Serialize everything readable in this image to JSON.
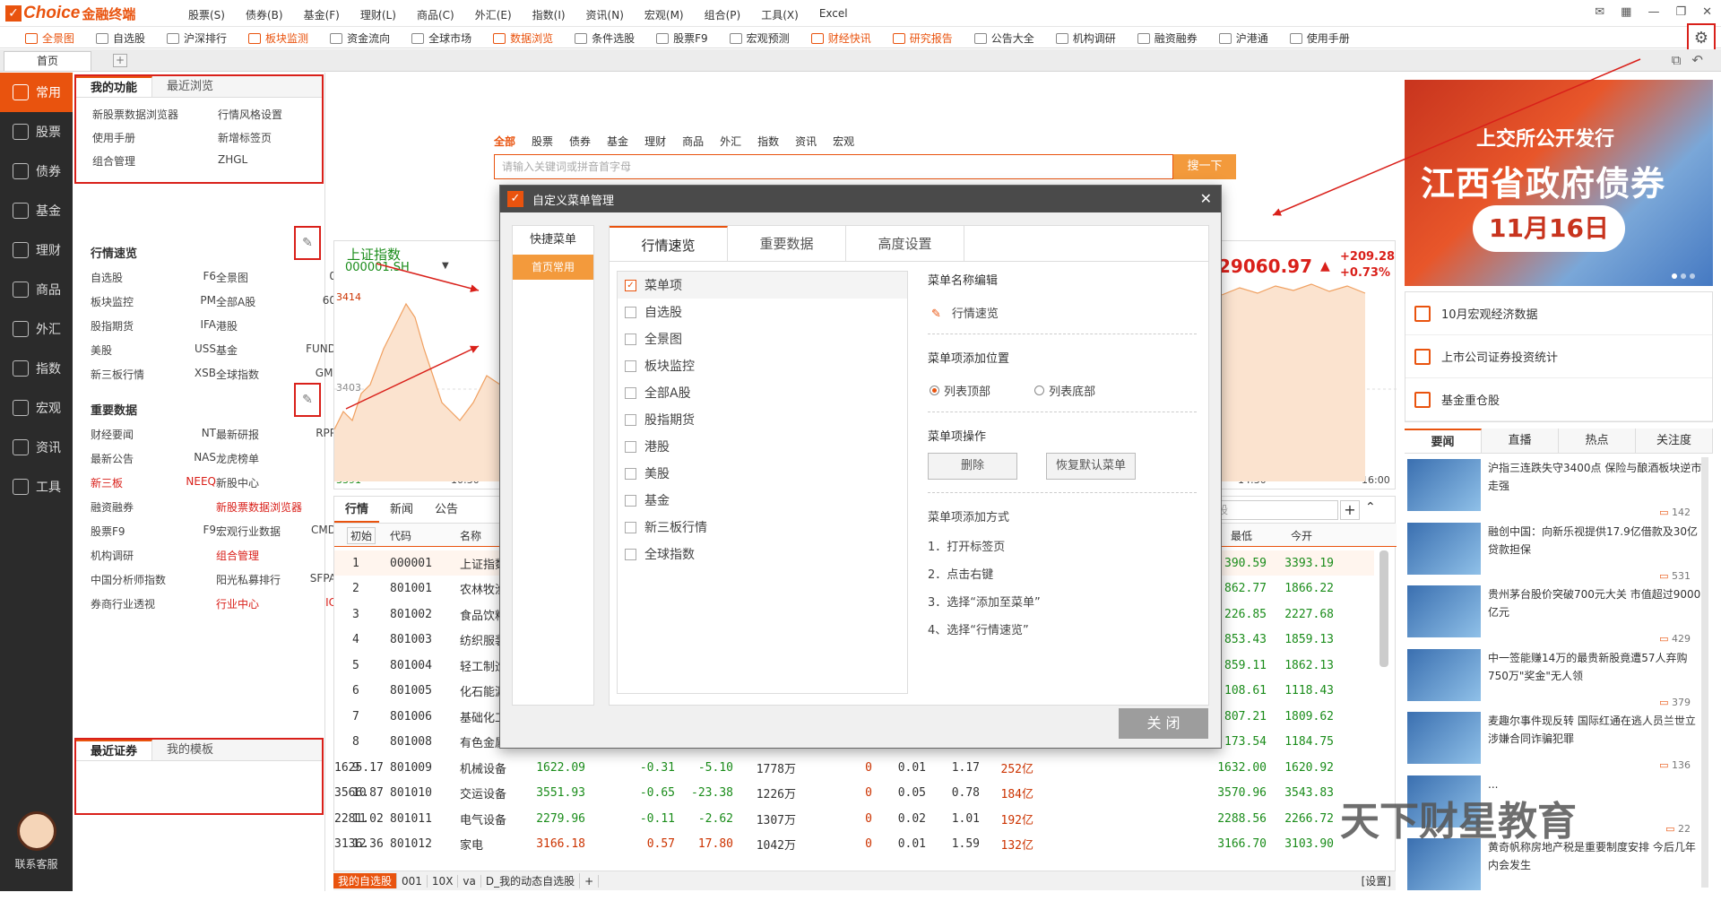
{
  "app": {
    "logo": "Choice",
    "logo_sub": "金融终端"
  },
  "menu": [
    "股票(S)",
    "债券(B)",
    "基金(F)",
    "理财(L)",
    "商品(C)",
    "外汇(E)",
    "指数(I)",
    "资讯(N)",
    "宏观(M)",
    "组合(P)",
    "工具(X)",
    "Excel"
  ],
  "toolbar": [
    {
      "label": "全景图",
      "hot": true
    },
    {
      "label": "自选股",
      "hot": false
    },
    {
      "label": "沪深排行",
      "hot": false
    },
    {
      "label": "板块监测",
      "hot": true
    },
    {
      "label": "资金流向",
      "hot": false
    },
    {
      "label": "全球市场",
      "hot": false
    },
    {
      "label": "数据浏览",
      "hot": true
    },
    {
      "label": "条件选股",
      "hot": false
    },
    {
      "label": "股票F9",
      "hot": false
    },
    {
      "label": "宏观预测",
      "hot": false
    },
    {
      "label": "财经快讯",
      "hot": true
    },
    {
      "label": "研究报告",
      "hot": true
    },
    {
      "label": "公告大全",
      "hot": false
    },
    {
      "label": "机构调研",
      "hot": false
    },
    {
      "label": "融资融券",
      "hot": false
    },
    {
      "label": "沪港通",
      "hot": false
    },
    {
      "label": "使用手册",
      "hot": false
    }
  ],
  "tabs": {
    "home": "首页",
    "add": "+"
  },
  "sidebar": [
    "常用",
    "股票",
    "债券",
    "基金",
    "理财",
    "商品",
    "外汇",
    "指数",
    "宏观",
    "资讯",
    "工具"
  ],
  "service": "联系客服",
  "left": {
    "tabs": [
      "我的功能",
      "最近浏览"
    ],
    "functions": [
      "新股票数据浏览器",
      "行情风格设置",
      "使用手册",
      "新增标签页",
      "组合管理",
      "ZHGL"
    ],
    "quick_title": "行情速览",
    "quick": [
      [
        "自选股",
        "F6",
        "全景图",
        "0"
      ],
      [
        "板块监控",
        "PM",
        "全部A股",
        "60"
      ],
      [
        "股指期货",
        "IFA",
        "港股",
        ""
      ],
      [
        "美股",
        "USS",
        "基金",
        "FUND"
      ],
      [
        "新三板行情",
        "XSB",
        "全球指数",
        "GMI"
      ]
    ],
    "data_title": "重要数据",
    "data": [
      [
        "财经要闻",
        "NT",
        "最新研报",
        "RPP"
      ],
      [
        "最新公告",
        "NAS",
        "龙虎榜单",
        ""
      ],
      [
        "新三板",
        "NEEQ",
        "新股中心",
        ""
      ],
      [
        "融资融券",
        "",
        "新股票数据浏览器",
        ""
      ],
      [
        "股票F9",
        "F9",
        "宏观行业数据",
        "CMD"
      ],
      [
        "机构调研",
        "",
        "组合管理",
        ""
      ],
      [
        "中国分析师指数",
        "",
        "阳光私募排行",
        "SFPA"
      ],
      [
        "券商行业透视",
        "",
        "行业中心",
        "IC"
      ]
    ],
    "data_red": [
      [
        false,
        false,
        false,
        false
      ],
      [
        false,
        false,
        false,
        false
      ],
      [
        true,
        true,
        false,
        false
      ],
      [
        false,
        false,
        true,
        false
      ],
      [
        false,
        false,
        false,
        false
      ],
      [
        false,
        false,
        true,
        false
      ],
      [
        false,
        false,
        false,
        false
      ],
      [
        false,
        false,
        true,
        true
      ]
    ],
    "recent_tabs": [
      "最近证券",
      "我的模板"
    ]
  },
  "search": {
    "tabs": [
      "全部",
      "股票",
      "债券",
      "基金",
      "理财",
      "商品",
      "外汇",
      "指数",
      "资讯",
      "宏观"
    ],
    "placeholder": "请输入关键词或拼音首字母",
    "button": "搜一下"
  },
  "chart": {
    "name": "上证指数",
    "code": "000001.SH",
    "y_top": "3414",
    "y_mid": "3403",
    "y_bot": "3391",
    "x_ticks": [
      "10:30",
      "14:30",
      "16:00"
    ],
    "right_value": "29060.97",
    "right_change": "+209.28",
    "right_pct": "+0.73%"
  },
  "table": {
    "tabs": [
      "行情",
      "新闻",
      "公告"
    ],
    "headers": [
      "初始",
      "代码",
      "名称",
      "最低",
      "今开"
    ],
    "search_placeholder": "股",
    "rows": [
      [
        "1",
        "000001",
        "上证指数",
        "",
        "",
        "",
        "",
        "",
        "",
        "",
        "",
        "390.59",
        "3393.19"
      ],
      [
        "2",
        "801001",
        "农林牧渔",
        "",
        "",
        "",
        "",
        "",
        "",
        "",
        "",
        "862.77",
        "1866.22"
      ],
      [
        "3",
        "801002",
        "食品饮料",
        "",
        "",
        "",
        "",
        "",
        "",
        "",
        "",
        "226.85",
        "2227.68"
      ],
      [
        "4",
        "801003",
        "纺织服装",
        "",
        "",
        "",
        "",
        "",
        "",
        "",
        "",
        "853.43",
        "1859.13"
      ],
      [
        "5",
        "801004",
        "轻工制造",
        "",
        "",
        "",
        "",
        "",
        "",
        "",
        "",
        "859.11",
        "1862.13"
      ],
      [
        "6",
        "801005",
        "化石能源",
        "",
        "",
        "",
        "",
        "",
        "",
        "",
        "",
        "108.61",
        "1118.43"
      ],
      [
        "7",
        "801006",
        "基础化工",
        "",
        "",
        "",
        "",
        "",
        "",
        "",
        "",
        "807.21",
        "1809.62"
      ],
      [
        "8",
        "801008",
        "有色金属",
        "",
        "",
        "",
        "",
        "",
        "",
        "",
        "",
        "173.54",
        "1184.75"
      ],
      [
        "9",
        "801009",
        "机械设备",
        "1622.09",
        "-0.31",
        "-5.10",
        "1778万",
        "0",
        "0.01",
        "1.17",
        "252亿",
        "1632.00",
        "1620.92",
        "1625.17"
      ],
      [
        "10",
        "801010",
        "交运设备",
        "3551.93",
        "-0.65",
        "-23.38",
        "1226万",
        "0",
        "0.05",
        "0.78",
        "184亿",
        "3570.96",
        "3543.83",
        "3566.87"
      ],
      [
        "11",
        "801011",
        "电气设备",
        "2279.96",
        "-0.11",
        "-2.62",
        "1307万",
        "0",
        "0.02",
        "1.01",
        "192亿",
        "2288.56",
        "2266.72",
        "2281.02"
      ],
      [
        "12",
        "801012",
        "家电",
        "3166.18",
        "0.57",
        "17.80",
        "1042万",
        "0",
        "0.01",
        "1.59",
        "132亿",
        "3166.70",
        "3103.90",
        "3136.36"
      ]
    ],
    "bottom": [
      "我的自选股",
      "001",
      "10X",
      "va",
      "D_我的动态自选股",
      "+",
      "[设置]"
    ]
  },
  "banner": {
    "line1": "上交所公开发行",
    "line2": "江西省政府债券",
    "line3": "11月16日"
  },
  "rlinks": [
    "10月宏观经济数据",
    "上市公司证券投资统计",
    "基金重仓股"
  ],
  "newstabs": [
    "要闻",
    "直播",
    "热点",
    "关注度"
  ],
  "news": [
    {
      "text": "沪指三连跌失守3400点 保险与酿酒板块逆市走强",
      "count": "142"
    },
    {
      "text": "融创中国：向新乐视提供17.9亿借款及30亿贷款担保",
      "count": "531"
    },
    {
      "text": "贵州茅台股价突破700元大关 市值超过9000亿元",
      "count": "429"
    },
    {
      "text": "中一签能赚14万的最贵新股竟遭57人弃购 750万\"奖金\"无人领",
      "count": "379"
    },
    {
      "text": "麦趣尔事件现反转 国际红通在逃人员兰世立涉嫌合同诈骗犯罪",
      "count": "136"
    },
    {
      "text": "...",
      "count": "22"
    },
    {
      "text": "黄奇帆称房地产税是重要制度安排 今后几年内会发生",
      "count": ""
    }
  ],
  "dialog": {
    "title": "自定义菜单管理",
    "left_title": "快捷菜单",
    "left_selected": "首页常用",
    "tabs": [
      "行情速览",
      "重要数据",
      "高度设置"
    ],
    "list_header": "菜单项",
    "items": [
      "自选股",
      "全景图",
      "板块监控",
      "全部A股",
      "股指期货",
      "港股",
      "美股",
      "基金",
      "新三板行情",
      "全球指数"
    ],
    "name_edit_title": "菜单名称编辑",
    "name_value": "行情速览",
    "position_title": "菜单项添加位置",
    "position_options": [
      "列表顶部",
      "列表底部"
    ],
    "ops_title": "菜单项操作",
    "ops": [
      "删除",
      "恢复默认菜单"
    ],
    "method_title": "菜单项添加方式",
    "steps": [
      "1．打开标签页",
      "2．点击右键",
      "3．选择“添加至菜单”",
      "4、选择“行情速览”"
    ],
    "close": "关 闭"
  },
  "watermark": "天下财星教育"
}
